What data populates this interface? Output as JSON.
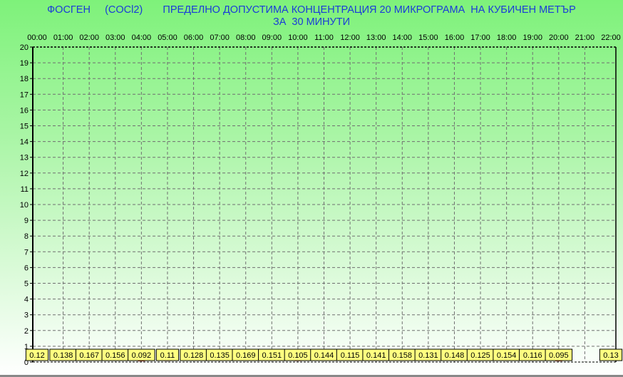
{
  "chart_data": {
    "type": "line",
    "title_line1": "ФОСГЕН     (COCl2)       ПРЕДЕЛНО ДОПУСТИМА КОНЦЕНТРАЦИЯ 20 МИКРОГРАМА  НА КУБИЧЕН МЕТЪР",
    "title_line2": "ЗА  30 МИНУТИ",
    "xlabel": "",
    "ylabel": "",
    "x_ticks": [
      "00:00",
      "01:00",
      "02:00",
      "03:00",
      "04:00",
      "05:00",
      "06:00",
      "07:00",
      "08:00",
      "09:00",
      "10:00",
      "11:00",
      "12:00",
      "13:00",
      "14:00",
      "15:00",
      "16:00",
      "17:00",
      "18:00",
      "19:00",
      "20:00",
      "21:00",
      "22:00"
    ],
    "ylim": [
      0,
      20
    ],
    "y_ticks": [
      0,
      1,
      2,
      3,
      4,
      5,
      6,
      7,
      8,
      9,
      10,
      11,
      12,
      13,
      14,
      15,
      16,
      17,
      18,
      19,
      20
    ],
    "grid": true,
    "series": [
      {
        "name": "COCl2",
        "x": [
          0,
          1,
          2,
          3,
          4,
          5,
          6,
          7,
          8,
          9,
          10,
          11,
          12,
          13,
          14,
          15,
          16,
          17,
          18,
          19,
          20,
          22
        ],
        "values": [
          0.12,
          0.138,
          0.167,
          0.156,
          0.092,
          0.11,
          0.128,
          0.135,
          0.169,
          0.151,
          0.105,
          0.144,
          0.115,
          0.141,
          0.158,
          0.131,
          0.148,
          0.125,
          0.154,
          0.116,
          0.095,
          0.13
        ],
        "labels": [
          "0.12",
          "0.138",
          "0.167",
          "0.156",
          "0.092",
          "0.11",
          "0.128",
          "0.135",
          "0.169",
          "0.151",
          "0.105",
          "0.144",
          "0.115",
          "0.141",
          "0.158",
          "0.131",
          "0.148",
          "0.125",
          "0.154",
          "0.116",
          "0.095",
          "0.13"
        ]
      }
    ],
    "colors": {
      "title": "#1a3cd8",
      "label_bg": "#ffff80",
      "marker": "#c03020"
    }
  }
}
